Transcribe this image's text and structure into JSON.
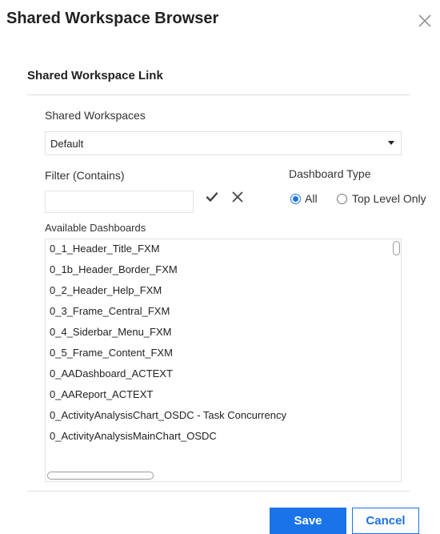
{
  "dialog": {
    "title": "Shared Workspace Browser",
    "section_title": "Shared Workspace Link"
  },
  "workspaces": {
    "label": "Shared Workspaces",
    "selected": "Default"
  },
  "filter": {
    "label": "Filter (Contains)",
    "value": "",
    "placeholder": ""
  },
  "dashboard_type": {
    "label": "Dashboard Type",
    "options": [
      {
        "label": "All",
        "checked": true
      },
      {
        "label": "Top Level Only",
        "checked": false
      }
    ]
  },
  "available": {
    "label": "Available Dashboards",
    "items": [
      "0_1_Header_Title_FXM",
      "0_1b_Header_Border_FXM",
      "0_2_Header_Help_FXM",
      "0_3_Frame_Central_FXM",
      "0_4_Siderbar_Menu_FXM",
      "0_5_Frame_Content_FXM",
      "0_AADashboard_ACTEXT",
      "0_AAReport_ACTEXT",
      "0_ActivityAnalysisChart_OSDC - Task Concurrency",
      "0_ActivityAnalysisMainChart_OSDC"
    ]
  },
  "buttons": {
    "save": "Save",
    "cancel": "Cancel"
  },
  "colors": {
    "accent": "#1a73e8"
  }
}
